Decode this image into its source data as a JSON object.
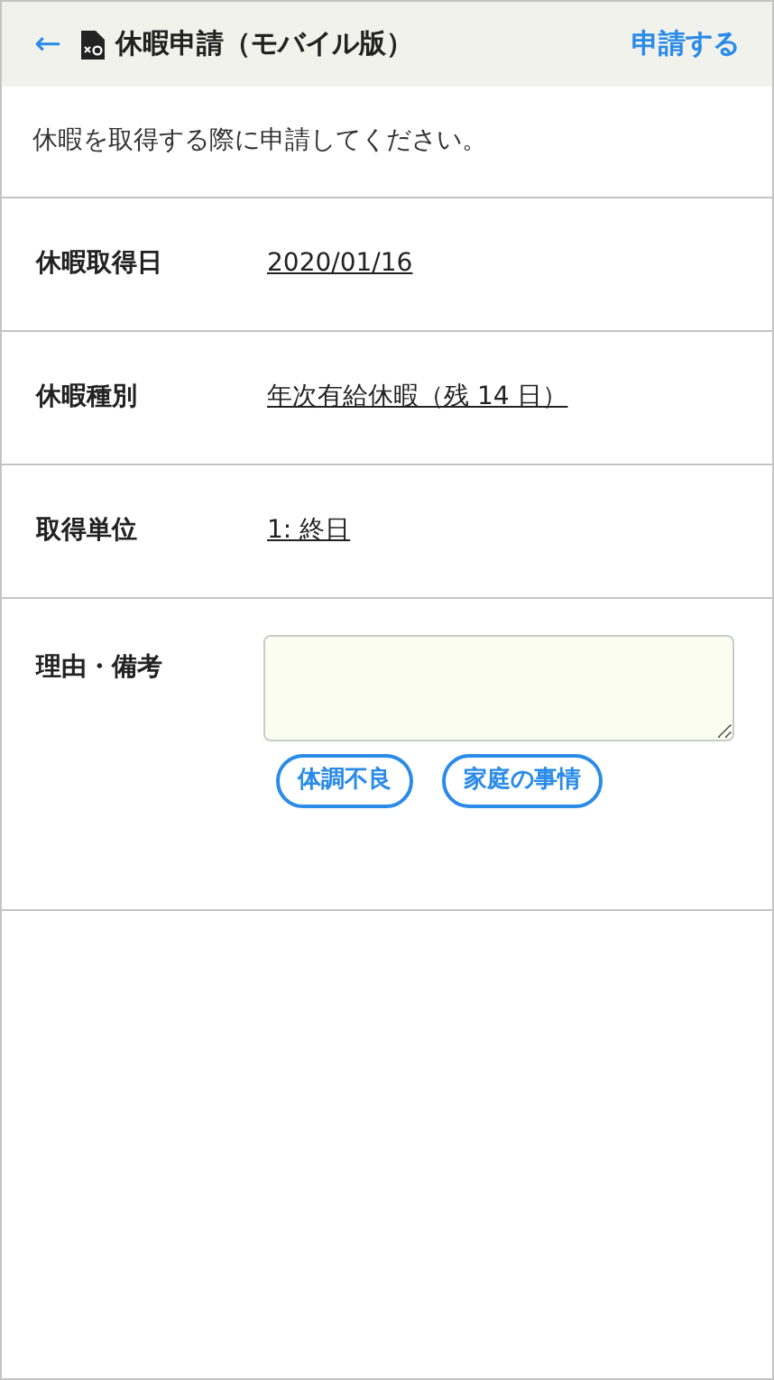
{
  "header": {
    "back": "←",
    "title": "休暇申請（モバイル版）",
    "action": "申請する"
  },
  "description": "休暇を取得する際に申請してください。",
  "fields": [
    {
      "kind": "link",
      "label": "休暇取得日",
      "value": "2020/01/16"
    },
    {
      "kind": "link",
      "label": "休暇種別",
      "value": "年次有給休暇（残 14 日）"
    },
    {
      "kind": "link",
      "label": "取得単位",
      "value": "1: 終日"
    },
    {
      "kind": "textarea",
      "label": "理由・備考",
      "chips": [
        "体調不良",
        "家庭の事情"
      ]
    }
  ]
}
